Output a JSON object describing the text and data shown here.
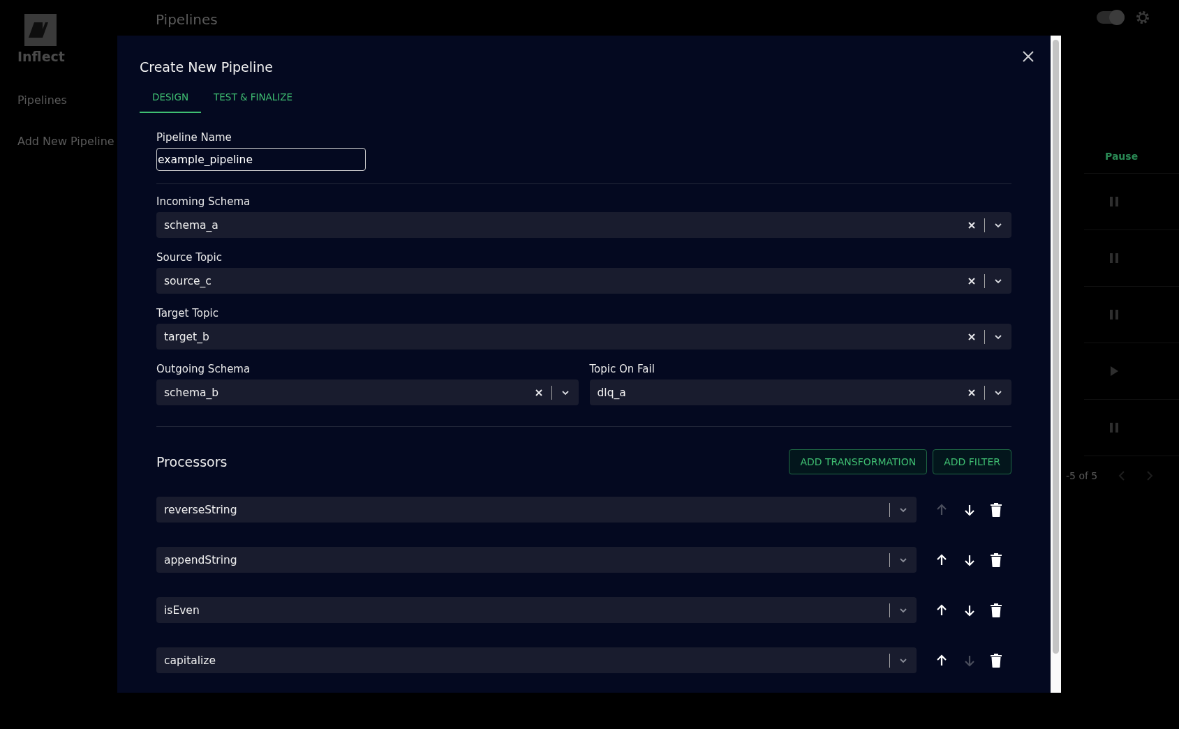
{
  "app": {
    "logo_text": "Inflect",
    "sidebar": [
      {
        "label": "Pipelines"
      },
      {
        "label": "Add New Pipeline"
      }
    ],
    "page_title": "Pipelines",
    "theme_toggle": {
      "on": true
    },
    "table": {
      "column": "Pause",
      "rows": [
        {
          "kind": "pause"
        },
        {
          "kind": "pause"
        },
        {
          "kind": "pause"
        },
        {
          "kind": "play"
        },
        {
          "kind": "pause"
        }
      ],
      "pagination": "-5 of 5"
    }
  },
  "dialog": {
    "title": "Create New Pipeline",
    "tabs": [
      {
        "label": "DESIGN",
        "selected": true
      },
      {
        "label": "TEST & FINALIZE",
        "selected": false
      }
    ],
    "pipeline_name": {
      "label": "Pipeline Name",
      "value": "example_pipeline"
    },
    "select_rows": [
      [
        {
          "label": "Incoming Schema",
          "value": "schema_a"
        }
      ],
      [
        {
          "label": "Source Topic",
          "value": "source_c"
        }
      ],
      [
        {
          "label": "Target Topic",
          "value": "target_b"
        }
      ],
      [
        {
          "label": "Outgoing Schema",
          "value": "schema_b"
        },
        {
          "label": "Topic On Fail",
          "value": "dlq_a"
        }
      ]
    ],
    "processors": {
      "title": "Processors",
      "buttons": [
        "ADD TRANSFORMATION",
        "ADD FILTER"
      ],
      "items": [
        {
          "value": "reverseString",
          "up_disabled": true,
          "down_disabled": false
        },
        {
          "value": "appendString",
          "up_disabled": false,
          "down_disabled": false
        },
        {
          "value": "isEven",
          "up_disabled": false,
          "down_disabled": false
        },
        {
          "value": "capitalize",
          "up_disabled": false,
          "down_disabled": true
        }
      ]
    }
  }
}
